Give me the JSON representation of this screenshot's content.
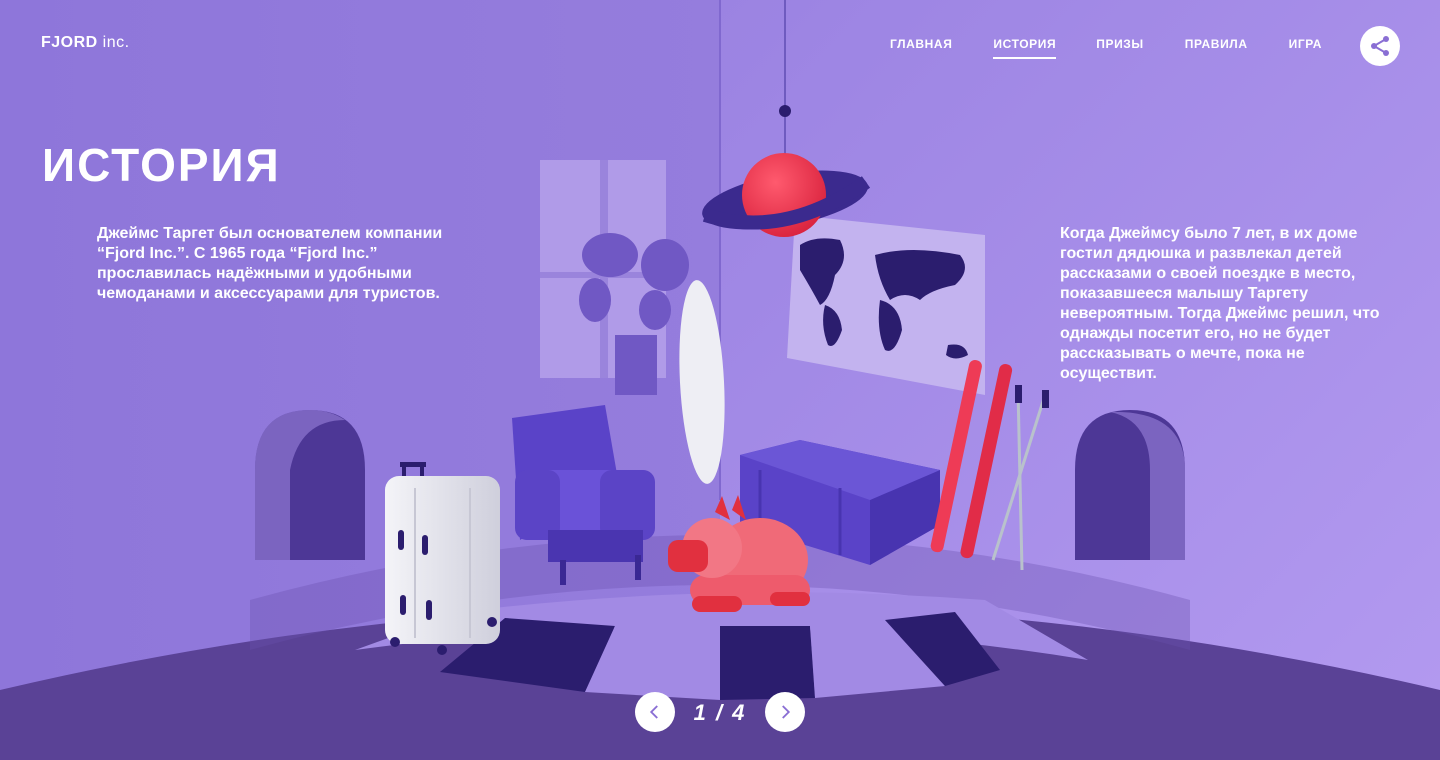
{
  "brand": {
    "name": "FJORD",
    "suffix": " inc."
  },
  "nav": {
    "items": [
      {
        "label": "ГЛАВНАЯ"
      },
      {
        "label": "ИСТОРИЯ",
        "active": true
      },
      {
        "label": "ПРИЗЫ"
      },
      {
        "label": "ПРАВИЛА"
      },
      {
        "label": "ИГРА"
      }
    ],
    "share_icon": "share-icon"
  },
  "page": {
    "title": "ИСТОРИЯ",
    "left_text": "Джеймс Таргет был основателем компании “Fjord Inc.”. С 1965 года “Fjord Inc.” прославилась надёжными и удобными чемоданами и аксессуарами для туристов.",
    "right_text": "Когда Джеймсу было 7 лет, в их доме гостил дядюшка и развлекал детей рассказами о своей поездке в место, показавшееся малышу Таргету невероятным. Тогда Джеймс решил, что однажды посетит его, но не будет рассказывать о мечте, пока не осуществит."
  },
  "pager": {
    "current": "1",
    "total": "4",
    "label": "1 / 4",
    "prev_icon": "chevron-left-icon",
    "next_icon": "chevron-right-icon"
  },
  "colors": {
    "background": "#8b74d9",
    "wall_right": "#9a7fe0",
    "floor": "#5a4296",
    "accent_red": "#ee3b56",
    "navy": "#2b1d6e",
    "white": "#ffffff"
  }
}
